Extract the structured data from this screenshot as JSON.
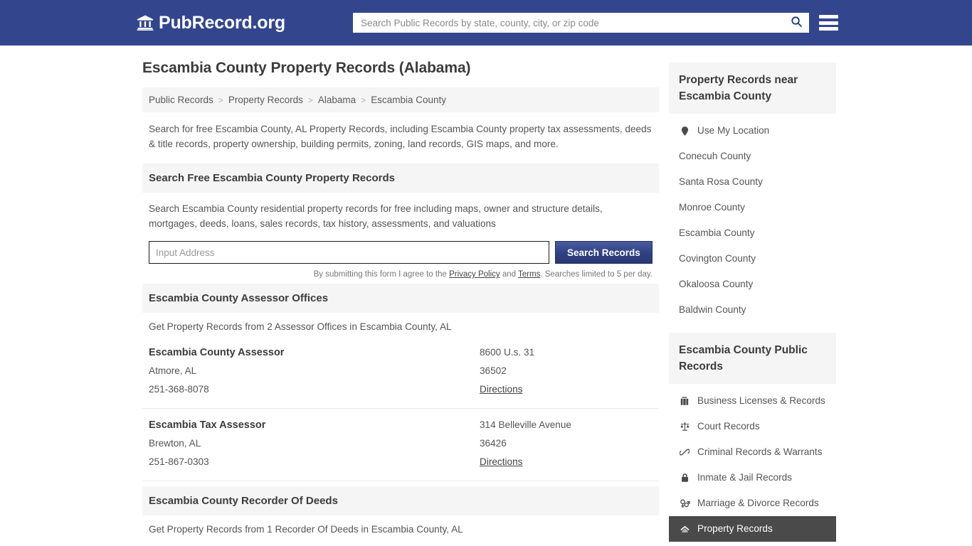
{
  "header": {
    "brand_name": "PubRecord.org",
    "brand_icon": "bank-icon",
    "search_placeholder": "Search Public Records by state, county, city, or zip code",
    "search_value": "",
    "search_icon": "search-icon",
    "menu_icon": "hamburger-menu-icon",
    "background_color": "#33468d"
  },
  "page": {
    "title": "Escambia County Property Records (Alabama)",
    "intro": "Search for free Escambia County, AL Property Records, including Escambia County property tax assessments, deeds & title records, property ownership, building permits, zoning, land records, GIS maps, and more."
  },
  "breadcrumb": [
    "Public Records",
    "Property Records",
    "Alabama",
    "Escambia County"
  ],
  "search_section": {
    "heading": "Search Free Escambia County Property Records",
    "description": "Search Escambia County residential property records for free including maps, owner and structure details, mortgages, deeds, loans, sales records, tax history, assessments, and valuations",
    "input_placeholder": "Input Address",
    "input_value": "",
    "submit_label": "Search Records",
    "note_prefix": "By submitting this form I agree to the ",
    "privacy_label": "Privacy Policy",
    "note_middle": " and ",
    "terms_label": "Terms",
    "note_suffix": ". Searches limited to 5 per day."
  },
  "assessor_section": {
    "heading": "Escambia County Assessor Offices",
    "note": "Get Property Records from 2 Assessor Offices in Escambia County, AL",
    "offices": [
      {
        "name": "Escambia County Assessor",
        "city_state": "Atmore, AL",
        "phone": "251-368-8078",
        "street": "8600 U.s. 31",
        "zip": "36502",
        "directions_label": "Directions"
      },
      {
        "name": "Escambia Tax Assessor",
        "city_state": "Brewton, AL",
        "phone": "251-867-0303",
        "street": "314 Belleville Avenue",
        "zip": "36426",
        "directions_label": "Directions"
      }
    ]
  },
  "recorder_section": {
    "heading": "Escambia County Recorder Of Deeds",
    "note": "Get Property Records from 1 Recorder Of Deeds in Escambia County, AL"
  },
  "sidebar": {
    "nearby": {
      "heading": "Property Records near Escambia County",
      "items": [
        {
          "label": "Use My Location",
          "icon": "map-pin-icon"
        },
        {
          "label": "Conecuh County",
          "icon": ""
        },
        {
          "label": "Santa Rosa County",
          "icon": ""
        },
        {
          "label": "Monroe County",
          "icon": ""
        },
        {
          "label": "Escambia County",
          "icon": ""
        },
        {
          "label": "Covington County",
          "icon": ""
        },
        {
          "label": "Okaloosa County",
          "icon": ""
        },
        {
          "label": "Baldwin County",
          "icon": ""
        }
      ]
    },
    "public_records": {
      "heading": "Escambia County Public Records",
      "items": [
        {
          "label": "Business Licenses & Records",
          "icon": "briefcase-icon",
          "active": false
        },
        {
          "label": "Court Records",
          "icon": "balance-scale-icon",
          "active": false
        },
        {
          "label": "Criminal Records & Warrants",
          "icon": "handcuffs-icon",
          "active": false
        },
        {
          "label": "Inmate & Jail Records",
          "icon": "lock-icon",
          "active": false
        },
        {
          "label": "Marriage & Divorce Records",
          "icon": "venus-mars-icon",
          "active": false
        },
        {
          "label": "Property Records",
          "icon": "house-icon",
          "active": true
        }
      ]
    }
  }
}
